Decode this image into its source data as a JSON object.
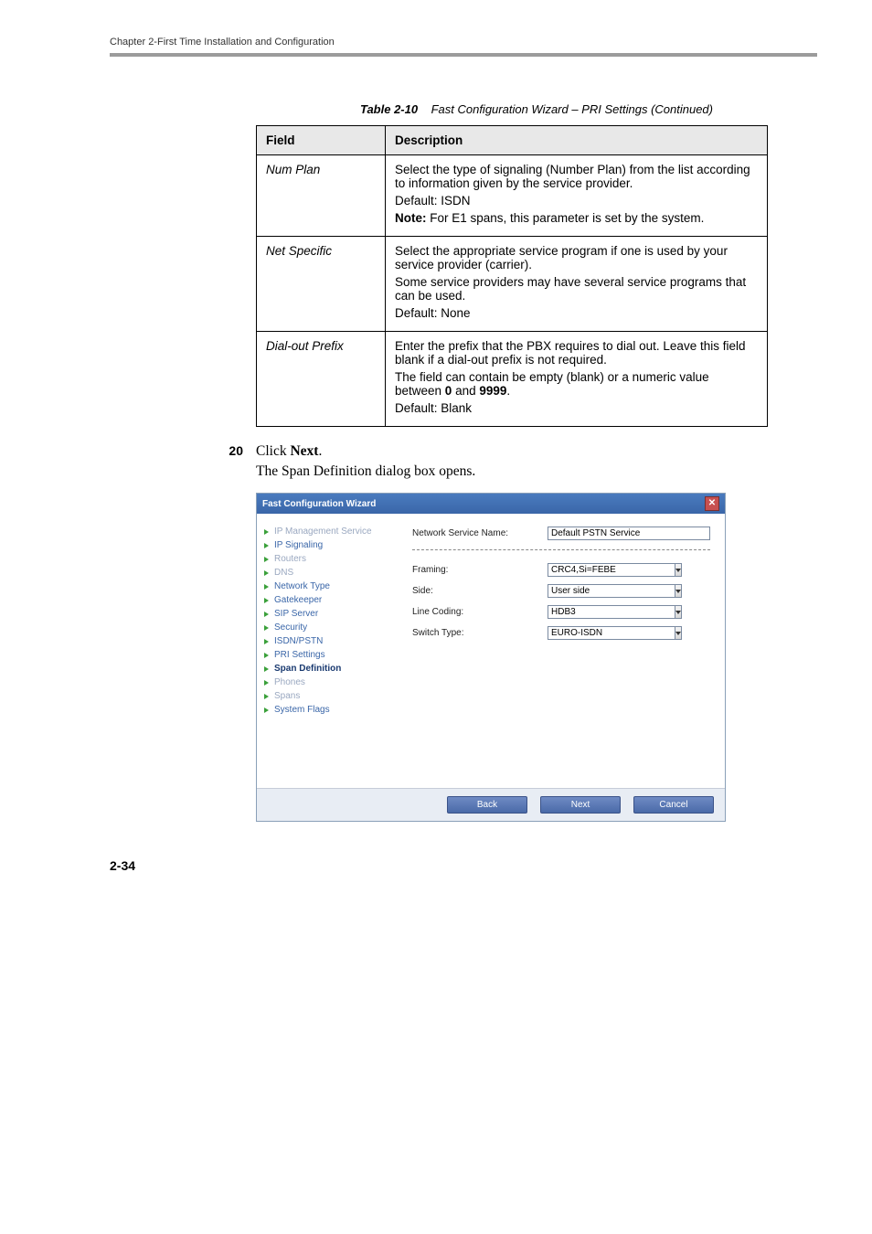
{
  "header": {
    "chapter": "Chapter 2-First Time Installation and Configuration"
  },
  "tableCaption": {
    "label": "Table 2-10",
    "title": "Fast Configuration Wizard – PRI Settings (Continued)"
  },
  "table": {
    "headers": {
      "field": "Field",
      "description": "Description"
    },
    "rows": [
      {
        "field": "Num Plan",
        "desc1": "Select the type of signaling (Number Plan) from the list according to information given by the service provider.",
        "desc2": "Default: ISDN",
        "desc3a": "Note:",
        "desc3b": " For E1 spans, this parameter is set by the system."
      },
      {
        "field": "Net Specific",
        "desc1": "Select the appropriate service program if one is used by your service provider (carrier).",
        "desc2": "Some service providers may have several service programs that can be used.",
        "desc3": "Default: None"
      },
      {
        "field": "Dial-out Prefix",
        "desc1": "Enter the prefix that the PBX requires to dial out. Leave this field blank if a dial-out prefix is not required.",
        "desc2a": "The field can contain be empty (blank) or a numeric value between ",
        "desc2b": "0",
        "desc2c": " and ",
        "desc2d": "9999",
        "desc2e": ".",
        "desc3": "Default: Blank"
      }
    ]
  },
  "step": {
    "num": "20",
    "pre": "Click ",
    "bold": "Next",
    "after": ".",
    "follow_pre": "The ",
    "follow_i": "Span Definition",
    "follow_post": " dialog box opens."
  },
  "dialog": {
    "title": "Fast Configuration Wizard",
    "sidebar": [
      {
        "label": "IP Management Service",
        "muted": true
      },
      {
        "label": "IP Signaling"
      },
      {
        "label": "Routers",
        "muted": true
      },
      {
        "label": "DNS",
        "muted": true
      },
      {
        "label": "Network Type"
      },
      {
        "label": "Gatekeeper"
      },
      {
        "label": "SIP Server"
      },
      {
        "label": "Security"
      },
      {
        "label": "ISDN/PSTN"
      },
      {
        "label": "PRI Settings"
      },
      {
        "label": "Span Definition",
        "bold": true
      },
      {
        "label": "Phones",
        "muted": true
      },
      {
        "label": "Spans",
        "muted": true
      },
      {
        "label": "System Flags"
      }
    ],
    "form": {
      "nsn_label": "Network Service Name:",
      "nsn_value": "Default PSTN Service",
      "framing_label": "Framing:",
      "framing_value": "CRC4,Si=FEBE",
      "side_label": "Side:",
      "side_value": "User side",
      "lc_label": "Line Coding:",
      "lc_value": "HDB3",
      "st_label": "Switch Type:",
      "st_value": "EURO-ISDN"
    },
    "buttons": {
      "back": "Back",
      "next": "Next",
      "cancel": "Cancel"
    }
  },
  "pageNumber": "2-34"
}
